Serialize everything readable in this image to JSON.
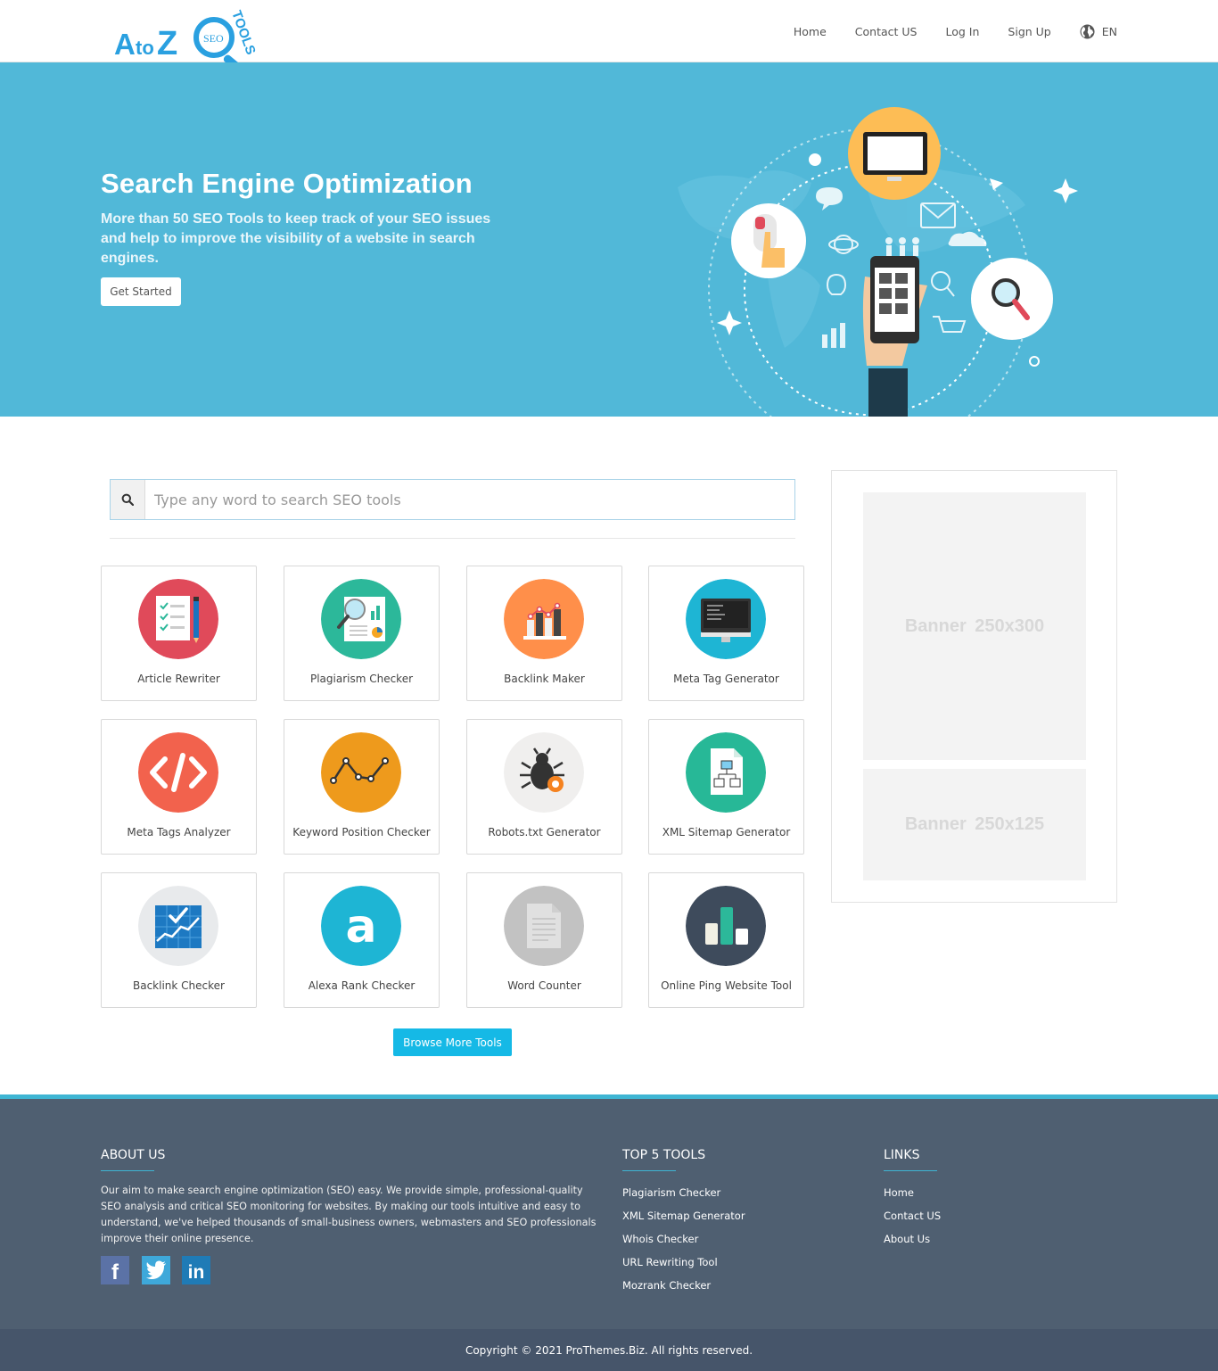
{
  "header": {
    "logo_text": "AtoZ SEO Tools",
    "nav": [
      "Home",
      "Contact US",
      "Log In",
      "Sign Up"
    ],
    "lang": "EN"
  },
  "hero": {
    "title": "Search Engine Optimization",
    "subtitle": "More than 50 SEO Tools to keep track of your SEO issues and help to improve the visibility of a website in search engines.",
    "cta": "Get Started"
  },
  "search": {
    "placeholder": "Type any word to search SEO tools"
  },
  "tools": [
    {
      "label": "Article Rewriter",
      "icon": "article-rewriter-icon",
      "color": "#e04a5a"
    },
    {
      "label": "Plagiarism Checker",
      "icon": "plagiarism-checker-icon",
      "color": "#2cb89a"
    },
    {
      "label": "Backlink Maker",
      "icon": "backlink-maker-icon",
      "color": "#ff8f4a"
    },
    {
      "label": "Meta Tag Generator",
      "icon": "meta-tag-generator-icon",
      "color": "#1eb5d4"
    },
    {
      "label": "Meta Tags Analyzer",
      "icon": "code-icon",
      "color": "#f2624d"
    },
    {
      "label": "Keyword Position Checker",
      "icon": "line-graph-icon",
      "color": "#ee9a1c"
    },
    {
      "label": "Robots.txt Generator",
      "icon": "bug-icon",
      "color": "#f0f0f0"
    },
    {
      "label": "XML Sitemap Generator",
      "icon": "sitemap-file-icon",
      "color": "#27b897"
    },
    {
      "label": "Backlink Checker",
      "icon": "chart-board-icon",
      "color": "#e8eaec"
    },
    {
      "label": "Alexa Rank Checker",
      "icon": "alexa-icon",
      "color": "#1eb5d4"
    },
    {
      "label": "Word Counter",
      "icon": "document-icon",
      "color": "#c2c2c2"
    },
    {
      "label": "Online Ping Website Tool",
      "icon": "bar-chart-icon",
      "color": "#3e4b5c"
    }
  ],
  "browse_label": "Browse More Tools",
  "banners": {
    "large": "Banner  250x300",
    "small": "Banner  250x125"
  },
  "footer": {
    "about_title": "ABOUT US",
    "about_text": "Our aim to make search engine optimization (SEO) easy. We provide simple, professional-quality SEO analysis and critical SEO monitoring for websites. By making our tools intuitive and easy to understand, we've helped thousands of small-business owners, webmasters and SEO professionals improve their online presence.",
    "social": [
      "facebook-icon",
      "twitter-icon",
      "linkedin-icon"
    ],
    "tools_title": "TOP 5 TOOLS",
    "tools": [
      "Plagiarism Checker",
      "XML Sitemap Generator",
      "Whois Checker",
      "URL Rewriting Tool",
      "Mozrank Checker"
    ],
    "links_title": "LINKS",
    "links": [
      "Home",
      "Contact US",
      "About Us"
    ],
    "copyright": "Copyright © 2021 ProThemes.Biz. All rights reserved."
  },
  "colors": {
    "hero_bg": "#51b8d8",
    "accent": "#15b9e6",
    "footer_bg": "#4f5f71"
  }
}
